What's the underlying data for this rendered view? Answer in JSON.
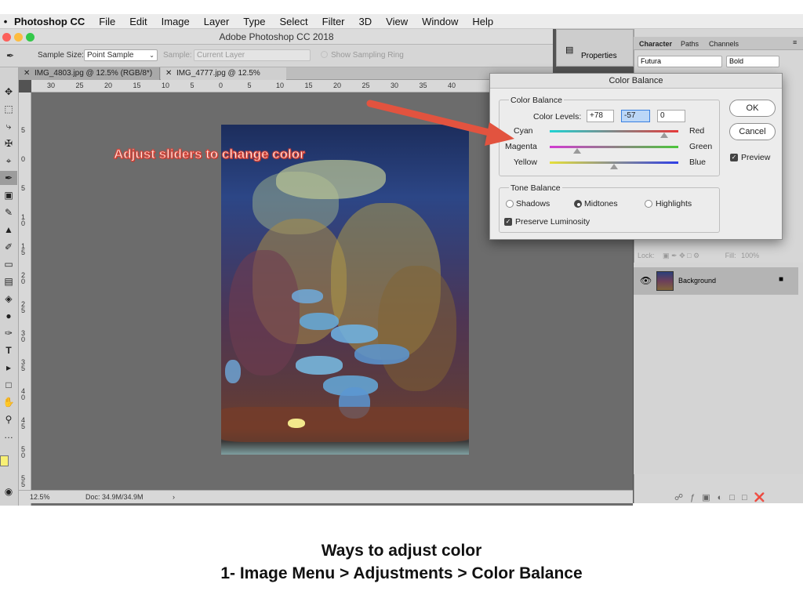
{
  "menubar": {
    "app_name": "Photoshop CC",
    "items": [
      "File",
      "Edit",
      "Image",
      "Layer",
      "Type",
      "Select",
      "Filter",
      "3D",
      "View",
      "Window",
      "Help"
    ]
  },
  "window": {
    "title": "Adobe Photoshop CC 2018"
  },
  "options_bar": {
    "sample_size_label": "Sample Size:",
    "sample_size_value": "Point Sample",
    "sample_label": "Sample:",
    "sample_value": "Current Layer",
    "show_ring": "Show Sampling Ring"
  },
  "doc_tabs": [
    {
      "label": "IMG_4803.jpg @ 12.5% (RGB/8*)"
    },
    {
      "label": "IMG_4777.jpg @ 12.5% (RGB/8)"
    }
  ],
  "ruler_top": [
    "30",
    "25",
    "20",
    "15",
    "10",
    "5",
    "0",
    "5",
    "10",
    "15",
    "20",
    "25",
    "30",
    "35",
    "40"
  ],
  "ruler_left": [
    "5",
    "0",
    "5",
    "1\n0",
    "1\n5",
    "2\n0",
    "2\n5",
    "3\n0",
    "3\n5",
    "4\n0",
    "4\n5",
    "5\n0",
    "5\n5"
  ],
  "status": {
    "zoom": "12.5%",
    "doc": "Doc: 34.9M/34.9M"
  },
  "properties_panel": {
    "label": "Properties"
  },
  "char_panel": {
    "tabs": [
      "Character",
      "Paths",
      "Channels"
    ],
    "font": "Futura",
    "style": "Bold"
  },
  "layers": {
    "lock_label": "Lock:",
    "fill_label": "Fill:",
    "fill_value": "100%",
    "layer_name": "Background"
  },
  "dialog": {
    "title": "Color Balance",
    "group_color": "Color Balance",
    "levels_label": "Color Levels:",
    "level1": "+78",
    "level2": "-57",
    "level3": "0",
    "sliders": [
      {
        "left": "Cyan",
        "right": "Red",
        "level": 78,
        "colors": [
          "#1fd3d3",
          "#e63a3a"
        ]
      },
      {
        "left": "Magenta",
        "right": "Green",
        "level": -57,
        "colors": [
          "#d23bd2",
          "#4cc63b"
        ]
      },
      {
        "left": "Yellow",
        "right": "Blue",
        "level": 0,
        "colors": [
          "#e6e03a",
          "#2e3ee6"
        ]
      }
    ],
    "group_tone": "Tone Balance",
    "tones": [
      "Shadows",
      "Midtones",
      "Highlights"
    ],
    "selected_tone": "Midtones",
    "preserve": "Preserve Luminosity",
    "preserve_checked": true,
    "ok": "OK",
    "cancel": "Cancel",
    "preview": "Preview",
    "preview_checked": true
  },
  "annotation": "Adjust sliders to change color",
  "caption": {
    "line1": "Ways to adjust color",
    "line2": "1- Image Menu > Adjustments > Color Balance"
  }
}
